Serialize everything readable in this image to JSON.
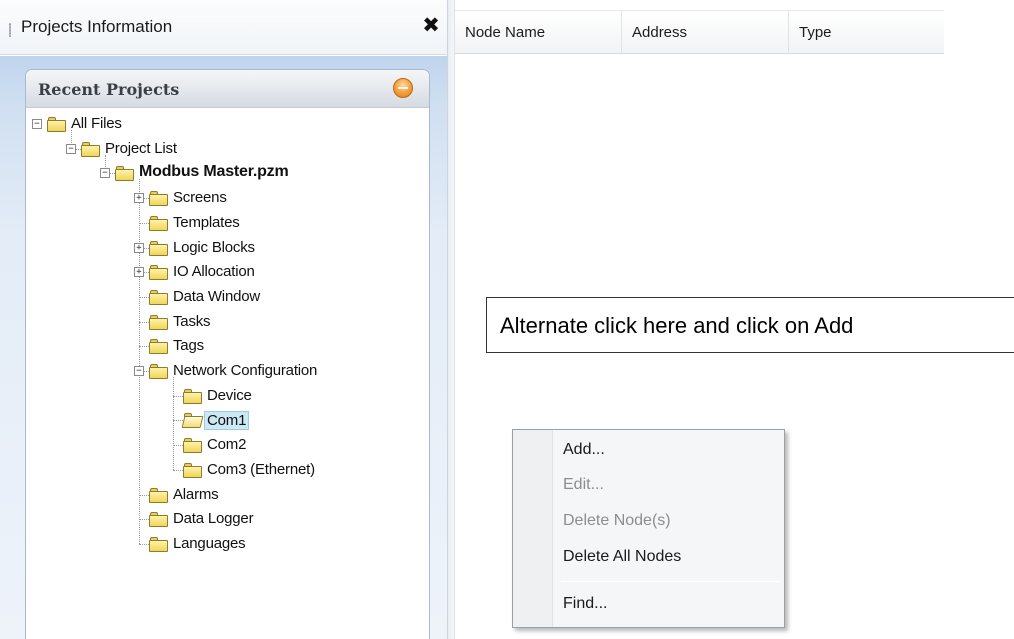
{
  "panel": {
    "title": "Projects Information",
    "close_glyph": "✖"
  },
  "recent_projects": {
    "title": "Recent Projects",
    "collapse_icon": "collapse-circle-icon",
    "collapse_color": "#f0962e"
  },
  "tree": {
    "expanded_glyph": "−",
    "collapsed_glyph": "+",
    "selected_highlight": "#cde8f5",
    "nodes": [
      {
        "label": "All Files",
        "state": "expanded"
      },
      {
        "label": "Project List",
        "state": "expanded"
      },
      {
        "label": "Modbus Master.pzm",
        "state": "expanded",
        "bold": true
      },
      {
        "label": "Screens",
        "state": "collapsed"
      },
      {
        "label": "Templates",
        "state": "leaf"
      },
      {
        "label": "Logic Blocks",
        "state": "collapsed"
      },
      {
        "label": "IO Allocation",
        "state": "collapsed"
      },
      {
        "label": "Data Window",
        "state": "leaf"
      },
      {
        "label": "Tasks",
        "state": "leaf"
      },
      {
        "label": "Tags",
        "state": "leaf"
      },
      {
        "label": "Network Configuration",
        "state": "expanded"
      },
      {
        "label": "Device",
        "state": "leaf"
      },
      {
        "label": "Com1",
        "state": "leaf",
        "selected": true,
        "icon": "open-folder-icon"
      },
      {
        "label": "Com2",
        "state": "leaf"
      },
      {
        "label": "Com3 (Ethernet)",
        "state": "leaf"
      },
      {
        "label": "Alarms",
        "state": "leaf"
      },
      {
        "label": "Data Logger",
        "state": "leaf"
      },
      {
        "label": "Languages",
        "state": "leaf"
      }
    ]
  },
  "node_table": {
    "columns": [
      "Node Name",
      "Address",
      "Type"
    ]
  },
  "callout": {
    "text": "Alternate click here and click on Add"
  },
  "context_menu": {
    "items": [
      {
        "label": "Add...",
        "enabled": true
      },
      {
        "label": "Edit...",
        "enabled": false
      },
      {
        "label": "Delete Node(s)",
        "enabled": false
      },
      {
        "label": "Delete All Nodes",
        "enabled": true
      },
      {
        "label": "Find...",
        "enabled": true
      }
    ]
  }
}
